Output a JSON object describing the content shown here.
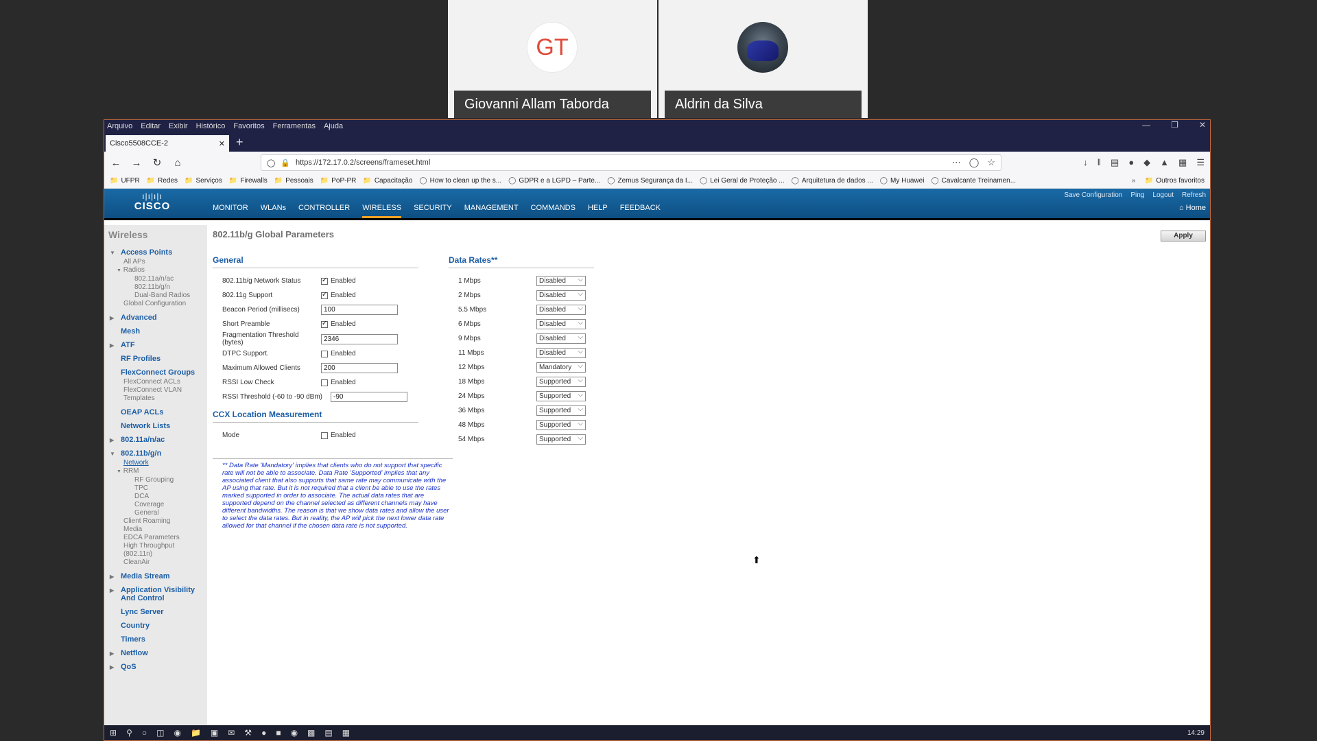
{
  "call": {
    "participants": [
      {
        "name": "Giovanni Allam Taborda",
        "initials": "GT"
      },
      {
        "name": "Aldrin da Silva"
      }
    ]
  },
  "browser": {
    "menu": [
      "Arquivo",
      "Editar",
      "Exibir",
      "Histórico",
      "Favoritos",
      "Ferramentas",
      "Ajuda"
    ],
    "tab_title": "Cisco5508CCE-2",
    "url": "https://172.17.0.2/screens/frameset.html",
    "bookmarks": [
      "UFPR",
      "Redes",
      "Serviços",
      "Firewalls",
      "Pessoais",
      "PoP-PR",
      "Capacitação",
      "How to clean up the s...",
      "GDPR e a LGPD – Parte...",
      "Zemus Segurança da I...",
      "Lei Geral de Proteção ...",
      "Arquitetura de dados ...",
      "My Huawei",
      "Cavalcante Treinamen..."
    ],
    "other_bookmarks": "Outros favoritos"
  },
  "cisco": {
    "logo_text": "CISCO",
    "top_menu": [
      "MONITOR",
      "WLANs",
      "CONTROLLER",
      "WIRELESS",
      "SECURITY",
      "MANAGEMENT",
      "COMMANDS",
      "HELP",
      "FEEDBACK"
    ],
    "top_links": [
      "Save Configuration",
      "Ping",
      "Logout",
      "Refresh"
    ],
    "home": "Home",
    "sidebar": {
      "title": "Wireless",
      "access_points": "Access Points",
      "all_aps": "All APs",
      "radios": "Radios",
      "radio_items": [
        "802.11a/n/ac",
        "802.11b/g/n",
        "Dual-Band Radios"
      ],
      "global_config": "Global Configuration",
      "advanced": "Advanced",
      "mesh": "Mesh",
      "atf": "ATF",
      "rf_profiles": "RF Profiles",
      "flexconnect_groups": "FlexConnect Groups",
      "flexconnect_acls": "FlexConnect ACLs",
      "flexconnect_vlan": "FlexConnect VLAN Templates",
      "oeap_acls": "OEAP ACLs",
      "network_lists": "Network Lists",
      "dot11a": "802.11a/n/ac",
      "dot11b": "802.11b/g/n",
      "network": "Network",
      "rrm": "RRM",
      "rrm_items": [
        "RF Grouping",
        "TPC",
        "DCA",
        "Coverage",
        "General"
      ],
      "client_roaming": "Client Roaming",
      "media": "Media",
      "edca": "EDCA Parameters",
      "high_throughput": "High Throughput (802.11n)",
      "cleanair": "CleanAir",
      "media_stream": "Media Stream",
      "avc": "Application Visibility And Control",
      "lync": "Lync Server",
      "country": "Country",
      "timers": "Timers",
      "netflow": "Netflow",
      "qos": "QoS"
    },
    "page_title": "802.11b/g Global Parameters",
    "apply": "Apply",
    "general": {
      "title": "General",
      "network_status": "802.11b/g Network Status",
      "g_support": "802.11g Support",
      "beacon_period": "Beacon Period (millisecs)",
      "beacon_value": "100",
      "short_preamble": "Short Preamble",
      "frag_threshold": "Fragmentation Threshold (bytes)",
      "frag_value": "2346",
      "dtpc": "DTPC Support.",
      "max_clients": "Maximum Allowed Clients",
      "max_clients_value": "200",
      "rssi_low": "RSSI Low Check",
      "rssi_threshold": "RSSI Threshold (-60 to -90 dBm)",
      "rssi_value": "-90",
      "enabled": "Enabled"
    },
    "ccx": {
      "title": "CCX Location Measurement",
      "mode": "Mode",
      "enabled": "Enabled"
    },
    "data_rates": {
      "title": "Data Rates**",
      "rows": [
        {
          "rate": "1 Mbps",
          "value": "Disabled"
        },
        {
          "rate": "2 Mbps",
          "value": "Disabled"
        },
        {
          "rate": "5.5 Mbps",
          "value": "Disabled"
        },
        {
          "rate": "6 Mbps",
          "value": "Disabled"
        },
        {
          "rate": "9 Mbps",
          "value": "Disabled"
        },
        {
          "rate": "11 Mbps",
          "value": "Disabled"
        },
        {
          "rate": "12 Mbps",
          "value": "Mandatory"
        },
        {
          "rate": "18 Mbps",
          "value": "Supported"
        },
        {
          "rate": "24 Mbps",
          "value": "Supported"
        },
        {
          "rate": "36 Mbps",
          "value": "Supported"
        },
        {
          "rate": "48 Mbps",
          "value": "Supported"
        },
        {
          "rate": "54 Mbps",
          "value": "Supported"
        }
      ]
    },
    "note": "** Data Rate 'Mandatory' implies that clients who do not support that specific rate will not be able to associate. Data Rate 'Supported' implies that any associated client that also supports that same rate may communicate with the AP using that rate. But it is not required that a client be able to use the rates marked supported in order to associate. The actual data rates that are supported depend on the channel selected as different channels may have different bandwidths. The reason is that we show data rates and allow the user to select the data rates. But in reality, the AP will pick the next lower data rate allowed for that channel if the chosen data rate is not supported."
  },
  "taskbar": {
    "clock": "14:29"
  }
}
